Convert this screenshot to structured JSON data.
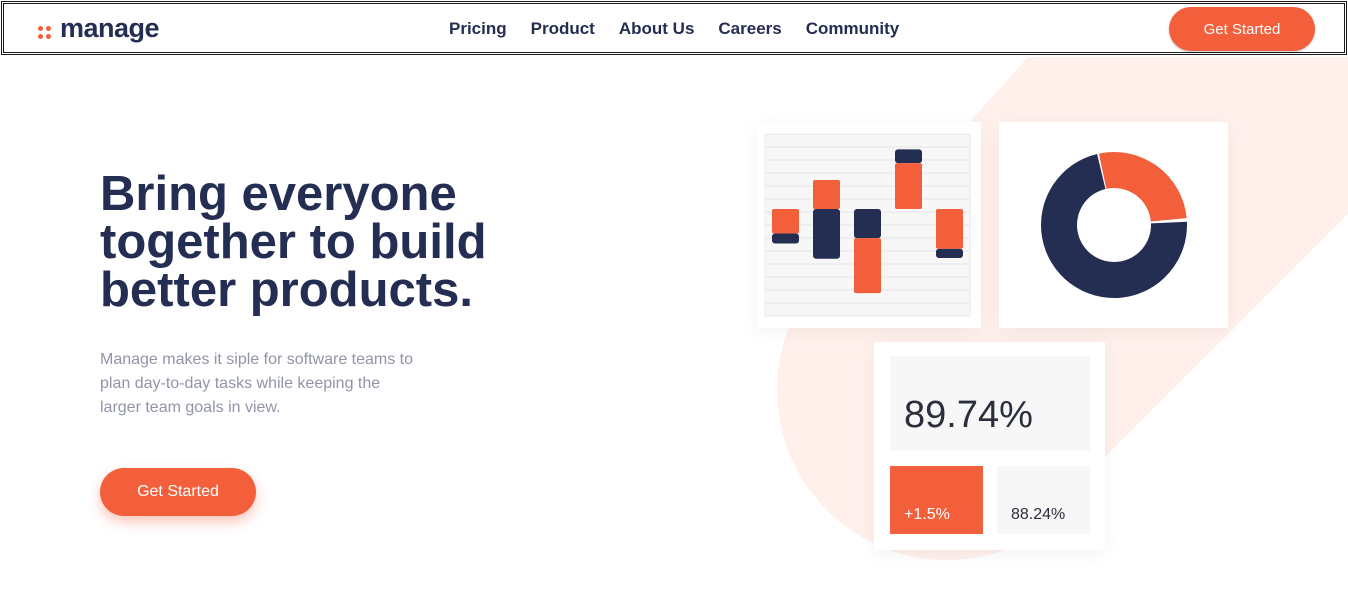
{
  "colors": {
    "accent": "#f25f3a",
    "navy": "#242d52",
    "muted": "#9095a7",
    "peach": "#fff0ec",
    "panel": "#f7f7f8"
  },
  "header": {
    "logo_text": "manage",
    "nav": [
      "Pricing",
      "Product",
      "About Us",
      "Careers",
      "Community"
    ],
    "cta_label": "Get Started"
  },
  "hero": {
    "title_lines": [
      "Bring everyone",
      "together to build",
      "better products."
    ],
    "description": "Manage makes it siple for software teams to plan day-to-day tasks while keeping the larger team goals in view.",
    "cta_label": "Get Started"
  },
  "stats": {
    "main_value": "89.74%",
    "positive_value": "+1.5%",
    "neutral_value": "88.24%"
  },
  "bar_chart": {
    "baseline": 0,
    "ylim": [
      -10,
      10
    ],
    "bars": [
      {
        "orange": [
          3.2,
          0.0
        ],
        "navy": [
          0.0,
          -1.3
        ]
      },
      {
        "orange": [
          7.0,
          3.2
        ],
        "navy": [
          3.2,
          -3.3
        ]
      },
      {
        "orange": [
          -0.6,
          -7.8
        ],
        "navy": [
          3.2,
          -0.6
        ]
      },
      {
        "orange": [
          9.2,
          3.2
        ],
        "navy": [
          11.0,
          9.2
        ]
      },
      {
        "orange": [
          3.2,
          -2.0
        ],
        "navy": [
          -2.0,
          -3.2
        ]
      }
    ]
  },
  "donut_chart": {
    "navy_fraction": 0.72,
    "orange_fraction": 0.28
  }
}
